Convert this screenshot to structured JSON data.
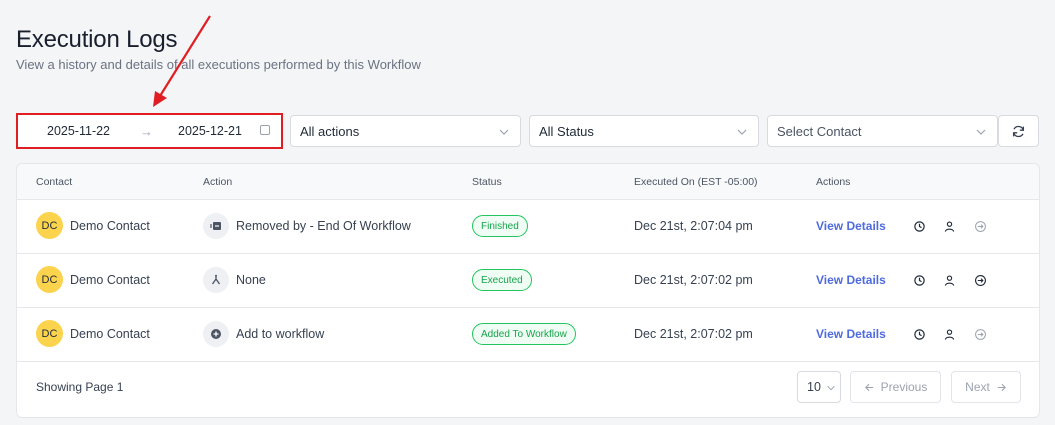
{
  "header": {
    "title": "Execution Logs",
    "subtitle": "View a history and details of all executions performed by this Workflow"
  },
  "filters": {
    "date_start": "2025-11-22",
    "date_separator": "→",
    "date_end": "2025-12-21",
    "actions_select": "All actions",
    "status_select": "All Status",
    "contact_placeholder": "Select Contact"
  },
  "table": {
    "columns": [
      "Contact",
      "Action",
      "Status",
      "Executed On (EST -05:00)",
      "Actions"
    ],
    "rows": [
      {
        "initials": "DC",
        "contact": "Demo Contact",
        "action_icon": "remove-icon",
        "action": "Removed by - End Of Workflow",
        "status": "Finished",
        "executed_on": "Dec 21st, 2:07:04 pm",
        "view_label": "View Details"
      },
      {
        "initials": "DC",
        "contact": "Demo Contact",
        "action_icon": "branch-icon",
        "action": "None",
        "status": "Executed",
        "executed_on": "Dec 21st, 2:07:02 pm",
        "view_label": "View Details"
      },
      {
        "initials": "DC",
        "contact": "Demo Contact",
        "action_icon": "plus-circle-icon",
        "action": "Add to workflow",
        "status": "Added To Workflow",
        "executed_on": "Dec 21st, 2:07:02 pm",
        "view_label": "View Details"
      }
    ]
  },
  "pagination": {
    "showing": "Showing Page 1",
    "page_size": "10",
    "previous_label": "Previous",
    "next_label": "Next"
  },
  "colors": {
    "annotation_red": "#e11d24",
    "link_blue": "#4f6bde",
    "status_green": "#16a34a",
    "avatar_yellow": "#fcd34d"
  }
}
